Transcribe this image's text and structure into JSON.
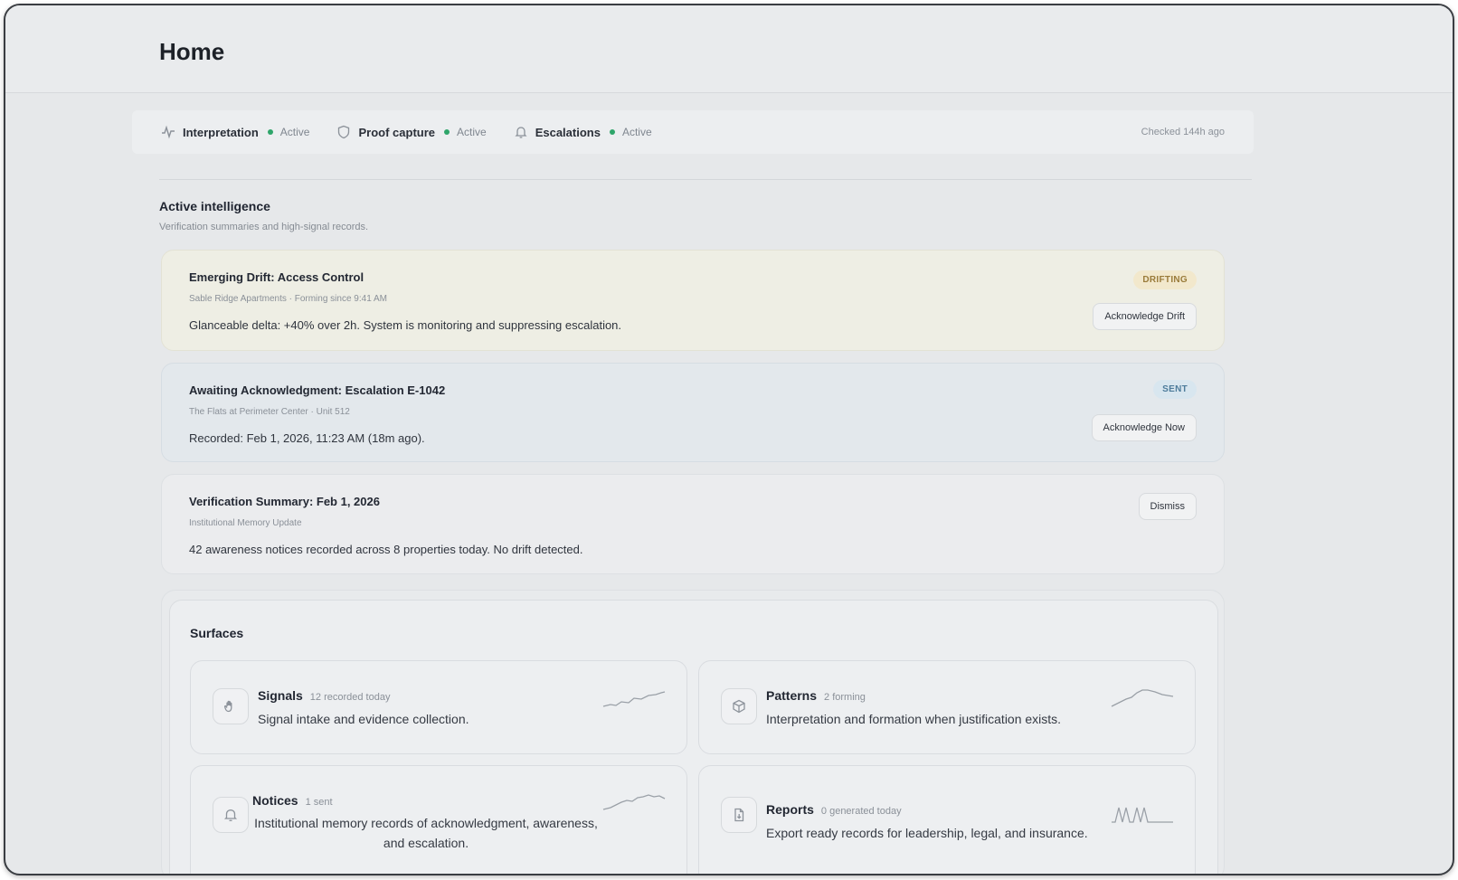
{
  "header": {
    "title": "Home"
  },
  "status_strip": {
    "items": [
      {
        "label": "Interpretation",
        "state": "Active",
        "icon": "activity-icon"
      },
      {
        "label": "Proof capture",
        "state": "Active",
        "icon": "shield-icon"
      },
      {
        "label": "Escalations",
        "state": "Active",
        "icon": "bell-icon"
      }
    ],
    "checked": "Checked 144h ago",
    "status_color": "#2ea56a"
  },
  "intelligence": {
    "title": "Active intelligence",
    "subtitle": "Verification summaries and high-signal records.",
    "cards": [
      {
        "title": "Emerging Drift: Access Control",
        "meta": "Sable Ridge Apartments · Forming since 9:41 AM",
        "body": "Glanceable delta: +40% over 2h. System is monitoring and suppressing escalation.",
        "badge": "DRIFTING",
        "action": "Acknowledge Drift"
      },
      {
        "title": "Awaiting Acknowledgment: Escalation E-1042",
        "meta": "The Flats at Perimeter Center · Unit 512",
        "body": "Recorded: Feb 1, 2026, 11:23 AM (18m ago).",
        "badge": "SENT",
        "action": "Acknowledge Now"
      },
      {
        "title": "Verification Summary: Feb 1, 2026",
        "meta": "Institutional Memory Update",
        "body": "42 awareness notices recorded across 8 properties today. No drift detected.",
        "action": "Dismiss"
      }
    ]
  },
  "surfaces": {
    "title": "Surfaces",
    "tiles": [
      {
        "name": "Signals",
        "count": "12 recorded today",
        "desc": "Signal intake and evidence collection.",
        "icon": "hand-icon"
      },
      {
        "name": "Patterns",
        "count": "2 forming",
        "desc": "Interpretation and formation when justification exists.",
        "icon": "layers-icon"
      },
      {
        "name": "Notices",
        "count": "1 sent",
        "desc": "Institutional memory records of acknowledgment, awareness, and escalation.",
        "icon": "bell-icon"
      },
      {
        "name": "Reports",
        "count": "0 generated today",
        "desc": "Export ready records for leadership, legal, and insurance.",
        "icon": "document-icon"
      }
    ]
  }
}
